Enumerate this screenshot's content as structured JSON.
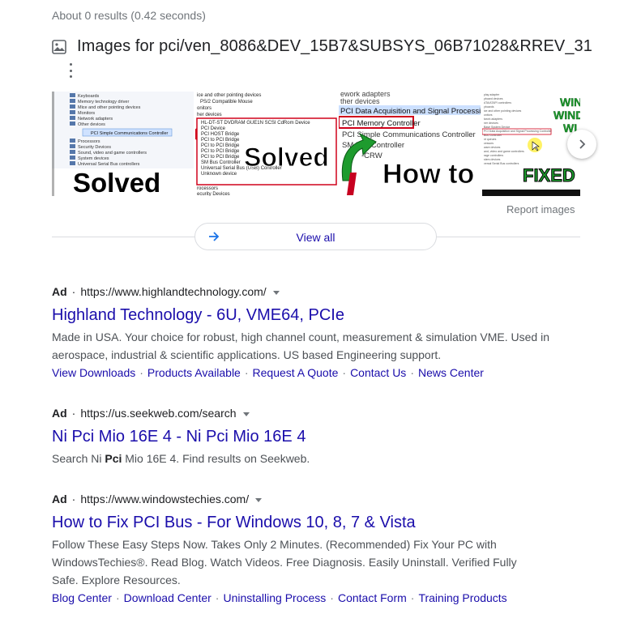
{
  "stats": "About 0 results (0.42 seconds)",
  "images": {
    "title": "Images for pci/ven_8086&DEV_15B7&SUBSYS_06B71028&RREV_31",
    "icon": "image-icon",
    "thumbnails": [
      {
        "overlay_text": "Solved",
        "caption": "PCI Simple Communications Controller"
      },
      {
        "overlay_text": "Solved",
        "caption": "PCI Device"
      },
      {
        "overlay_text": "How to fi",
        "caption": "PCI Memory Controller"
      },
      {
        "overlay_text": "FIXED",
        "caption": "WIN"
      }
    ],
    "report_label": "Report images",
    "view_all_label": "View all"
  },
  "ads": [
    {
      "badge": "Ad",
      "url": "https://www.highlandtechnology.com/",
      "title": "Highland Technology - 6U, VME64, PCIe",
      "desc": "Made in USA. Your choice for robust, high channel count, measurement & simulation VME. Used in aerospace, industrial & scientific applications. US based Engineering support.",
      "sitelinks": [
        "View Downloads",
        "Products Available",
        "Request A Quote",
        "Contact Us",
        "News Center"
      ]
    },
    {
      "badge": "Ad",
      "url": "https://us.seekweb.com/search",
      "title": "Ni Pci Mio 16E 4 - Ni Pci Mio 16E 4",
      "desc_pre": "Search Ni ",
      "desc_bold": "Pci",
      "desc_post": " Mio 16E 4. Find results on Seekweb.",
      "sitelinks": []
    },
    {
      "badge": "Ad",
      "url": "https://www.windowstechies.com/",
      "title": "How to Fix PCI Bus - For Windows 10, 8, 7 & Vista",
      "desc": "Follow These Easy Steps Now. Takes Only 2 Minutes. (Recommended) Fix Your PC with WindowsTechies®. Read Blog. Watch Videos. Free Diagnosis. Easily Uninstall. Verified Fully Safe. Explore Resources.",
      "sitelinks": [
        "Blog Center",
        "Download Center",
        "Uninstalling Process",
        "Contact Form",
        "Training Products"
      ]
    }
  ],
  "colors": {
    "link": "#1a0dab",
    "text": "#202124",
    "muted": "#70757a",
    "snippet": "#4d5156"
  }
}
